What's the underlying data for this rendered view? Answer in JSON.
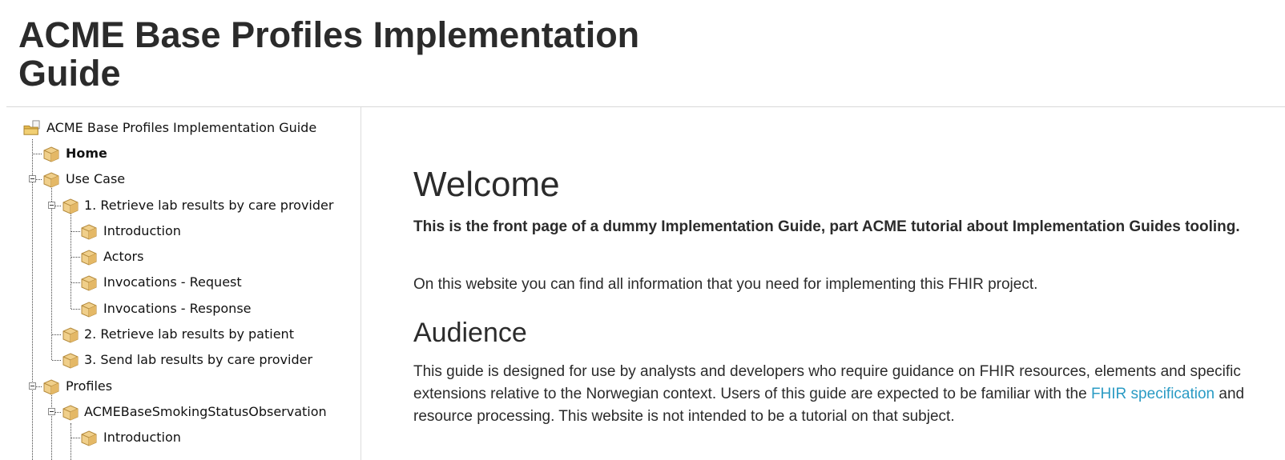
{
  "header": {
    "title": "ACME Base Profiles Implementation Guide"
  },
  "sidebar": {
    "root": {
      "label": "ACME Base Profiles Implementation Guide",
      "icon": "folder-icon"
    },
    "items": [
      {
        "label": "Home",
        "icon": "package-icon",
        "active": true
      },
      {
        "label": "Use Case",
        "icon": "package-icon",
        "expanded": true
      },
      {
        "label": "1. Retrieve lab results by care provider",
        "icon": "package-icon",
        "expanded": true
      },
      {
        "label": "Introduction",
        "icon": "package-icon"
      },
      {
        "label": "Actors",
        "icon": "package-icon"
      },
      {
        "label": "Invocations - Request",
        "icon": "package-icon"
      },
      {
        "label": "Invocations - Response",
        "icon": "package-icon"
      },
      {
        "label": "2. Retrieve lab results by patient",
        "icon": "package-icon"
      },
      {
        "label": "3. Send lab results by care provider",
        "icon": "package-icon"
      },
      {
        "label": "Profiles",
        "icon": "package-icon",
        "expanded": true
      },
      {
        "label": "ACMEBaseSmokingStatusObservation",
        "icon": "package-icon",
        "expanded": true
      },
      {
        "label": "Introduction",
        "icon": "package-icon"
      }
    ]
  },
  "main": {
    "welcome_heading": "Welcome",
    "intro_bold": "This is the front page of a dummy Implementation Guide, part ACME tutorial about Implementation Guides tooling.",
    "intro_text": "On this website you can find all information that you need for implementing this FHIR project.",
    "audience_heading": "Audience",
    "audience_text_before": "This guide is designed for use by analysts and developers who require guidance on FHIR resources, elements and specific extensions relative to the Norwegian context. Users of this guide are expected to be familiar with the ",
    "audience_link": "FHIR specification",
    "audience_text_after": " and resource processing. This website is not intended to be a tutorial on that subject."
  },
  "colors": {
    "link": "#2a9bc4",
    "text": "#2b2b2b",
    "divider": "#d8d8d8"
  }
}
